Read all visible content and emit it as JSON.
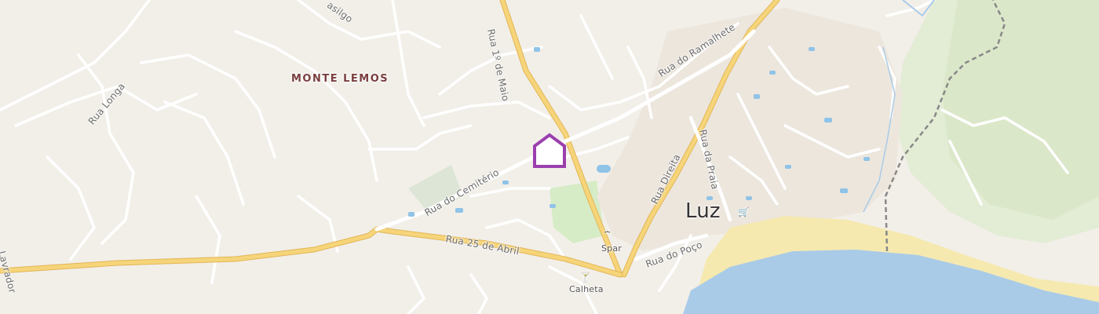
{
  "map": {
    "district_label": "MONTE LEMOS",
    "town_label": "Luz",
    "streets": {
      "rua_1_de_maio": "Rua 1º de Maio",
      "rua_do_ramalhete": "Rua do Ramalhete",
      "rua_longa": "Rua Longa",
      "rua_do_cemiterio": "Rua do Cemitério",
      "rua_25_de_abril": "Rua 25 de Abril",
      "rua_direita": "Rua Direita",
      "rua_da_praia": "Rua da Praia",
      "rua_do_poco": "Rua do Poço",
      "lavrador": "Lavrador",
      "basilgo": "asilgo"
    },
    "pois": {
      "spar": "Spar",
      "calheta": "Calheta"
    },
    "icons": {
      "marker": "home-marker-icon",
      "shop": "shopping-basket-icon",
      "bar": "cocktail-bar-icon",
      "cart": "shopping-cart-icon"
    },
    "colors": {
      "land": "#f2efe9",
      "water": "#a9cbe8",
      "sand": "#f5e9b0",
      "park": "#d6ecc6",
      "main_road": "#f6d57a",
      "marker": "#9b3fae"
    }
  }
}
